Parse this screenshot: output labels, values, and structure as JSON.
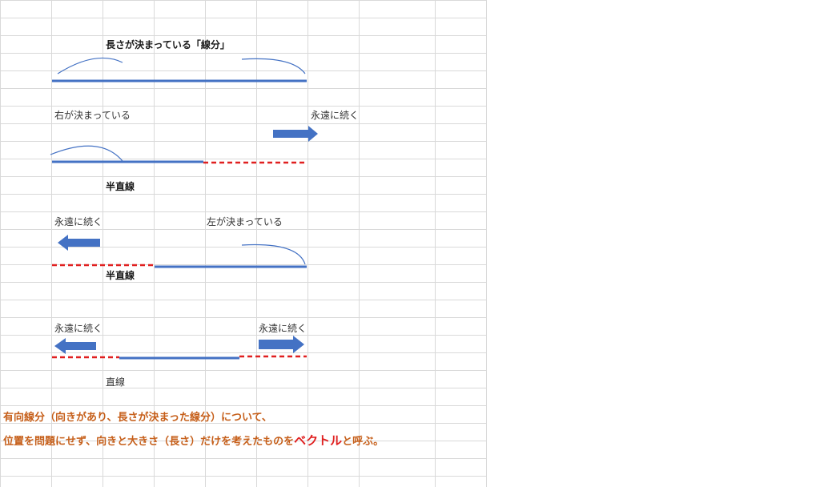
{
  "title": "長さが決まっている「線分」",
  "sections": {
    "segment": {
      "label": "長さが決まっている「線分」"
    },
    "ray_right": {
      "left_label": "右が決まっている",
      "right_label": "永遠に続く",
      "name": "半直線"
    },
    "ray_left": {
      "left_label": "永遠に続く",
      "right_label": "左が決まっている",
      "name": "半直線"
    },
    "line": {
      "left_label": "永遠に続く",
      "right_label": "永遠に続く",
      "name": "直線"
    }
  },
  "summary": {
    "line1": "有向線分（向きがあり、長さが決まった線分）について、",
    "line2_pre": "位置を問題にせず、向きと大きさ（長さ）だけを考えたものを",
    "line2_emph": "ベクトル",
    "line2_post": "と呼ぶ。"
  },
  "colors": {
    "solid_line": "#4472c4",
    "dashed_line": "#e02020",
    "arrow_fill": "#4472c4",
    "summary_text": "#c65f1a",
    "grid": "#d9d9d9"
  }
}
